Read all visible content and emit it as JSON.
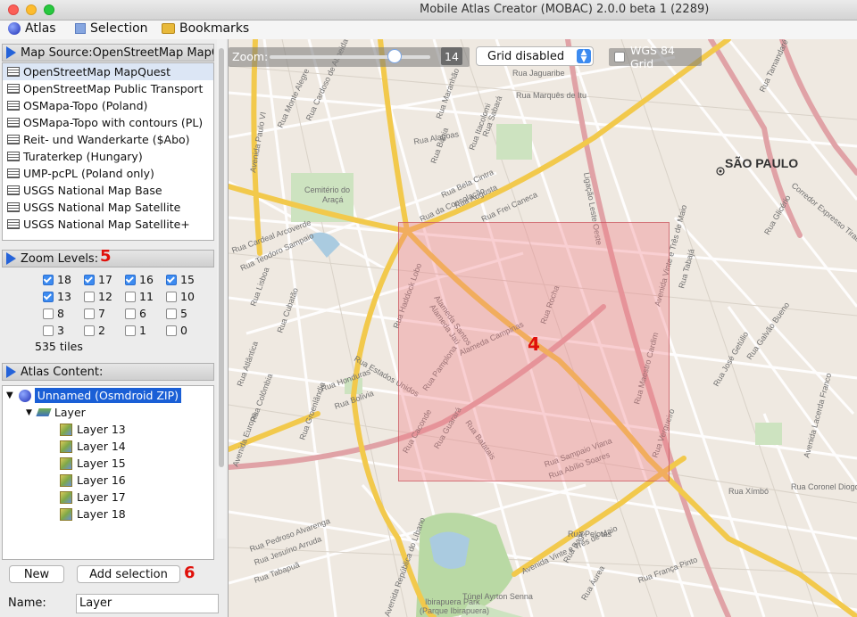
{
  "window": {
    "title": "Mobile Atlas Creator (MOBAC) 2.0.0 beta 1 (2289)"
  },
  "menu": {
    "atlas": "Atlas",
    "selection": "Selection",
    "bookmarks": "Bookmarks"
  },
  "map_source": {
    "header": "Map Source:OpenStreetMap MapQuest",
    "items": [
      {
        "label": "OpenStreetMap MapQuest",
        "selected": true
      },
      {
        "label": "OpenStreetMap Public Transport"
      },
      {
        "label": "OSMapa-Topo (Poland)"
      },
      {
        "label": "OSMapa-Topo with contours (PL)"
      },
      {
        "label": "Reit- und Wanderkarte ($Abo)"
      },
      {
        "label": "Turaterkep (Hungary)"
      },
      {
        "label": "UMP-pcPL (Poland only)"
      },
      {
        "label": "USGS National Map Base"
      },
      {
        "label": "USGS National Map Satellite"
      },
      {
        "label": "USGS National Map Satellite+"
      }
    ]
  },
  "zoom_levels": {
    "header": "Zoom Levels:",
    "marker": "5",
    "levels": [
      {
        "label": "18",
        "checked": true
      },
      {
        "label": "17",
        "checked": true
      },
      {
        "label": "16",
        "checked": true
      },
      {
        "label": "15",
        "checked": true
      },
      {
        "label": "13",
        "checked": true
      },
      {
        "label": "12",
        "checked": false
      },
      {
        "label": "11",
        "checked": false
      },
      {
        "label": "10",
        "checked": false
      },
      {
        "label": "8",
        "checked": false
      },
      {
        "label": "7",
        "checked": false
      },
      {
        "label": "6",
        "checked": false
      },
      {
        "label": "5",
        "checked": false
      },
      {
        "label": "3",
        "checked": false
      },
      {
        "label": "2",
        "checked": false
      },
      {
        "label": "1",
        "checked": false
      },
      {
        "label": "0",
        "checked": false
      }
    ],
    "tiles": "535 tiles"
  },
  "atlas_content": {
    "header": "Atlas Content:",
    "root": "Unnamed (Osmdroid ZIP)",
    "layer": "Layer",
    "children": [
      "Layer 13",
      "Layer 14",
      "Layer 15",
      "Layer 16",
      "Layer 17",
      "Layer 18"
    ]
  },
  "buttons": {
    "new": "New",
    "add_selection": "Add selection",
    "marker": "6"
  },
  "name_field": {
    "label": "Name:",
    "value": "Layer"
  },
  "map": {
    "zoom_label": "Zoom:",
    "zoom_value": "14",
    "grid_option": "Grid disabled",
    "wgs_label": "WGS 84 Grid",
    "city_label": "SÃO PAULO",
    "selection_marker": "4",
    "streets": [
      "Rua da Consolação",
      "Avenida Paulo VI",
      "Cemitério do Araçá",
      "Rua Cardeal Arcoverde",
      "Rua Teodoro Sampaio",
      "Rua Augusta",
      "Rua Frei Caneca",
      "Rua Bela Cintra",
      "Alameda Santos",
      "Alameda Jaú",
      "Alameda Campinas",
      "Rua Estados Unidos",
      "Rua Pamplona",
      "Rua Batatais",
      "Rua Haddock Lobo",
      "Avenida Vinte e Três de Maio",
      "Rua Vergueiro",
      "Ligação Leste Oeste",
      "Corredor Expresso Tiradentes",
      "Rua Sampaio Viana",
      "Rua Abílio Soares",
      "Avenida Brasil",
      "Rua Tutóia",
      "Rua Caconde",
      "Rua Guarará",
      "Avenida República do Líbano",
      "Túnel Ayrton Senna",
      "Ibirapuera Park",
      "(Parque Ibirapuera)",
      "Rua Pelotas",
      "Rua Bagé",
      "Rua Áurea",
      "Rua Xímbó",
      "Rua Coronel Diogo",
      "Rua França Pinto",
      "Avenida Europa",
      "Rua Groenlândia",
      "Rua Colômbia",
      "Rua Honduras",
      "Rua Bolívia",
      "Rua Maranhão",
      "Rua Sergipe",
      "Rua Itacolomi",
      "Rua Sabará",
      "Rua Jaguaribe",
      "Rua Marquês de Itu",
      "Rua Alagoas",
      "Rua Bahia",
      "Rua Atlântica",
      "Rua Lisboa",
      "Rua Pedroso Alvarenga",
      "Rua Jesuíno Arruda",
      "Rua Tabapuã",
      "Avenida Lacerda Franco",
      "Rua Vergueiro",
      "Rua Galvão Bueno",
      "Rua Tamandaré",
      "Rua José Getúlio",
      "Rua Cubatão",
      "Rua Tutóia",
      "Rua Maestro Cardim",
      "Rua Rocha"
    ]
  }
}
